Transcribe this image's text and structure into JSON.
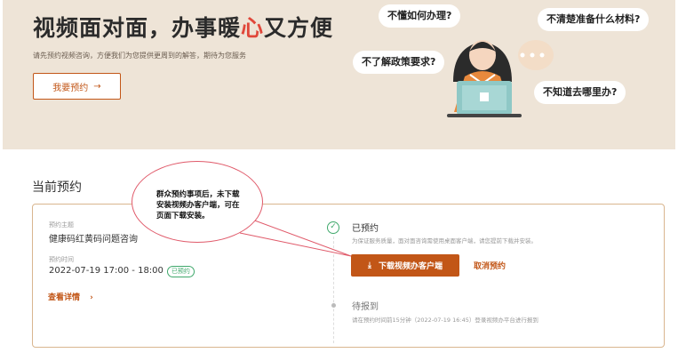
{
  "banner": {
    "title_pre": "视频面对面，办事暖",
    "title_heart": "心",
    "title_post": "又方便",
    "subtitle": "请先预约视频咨询，方便我们为您提供更周到的解答，期待为您服务",
    "book_button": "我要预约",
    "bubbles": [
      "不懂如何办理?",
      "不清楚准备什么材料?",
      "不了解政策要求?",
      "不知道去哪里办?"
    ]
  },
  "section_title": "当前预约",
  "card": {
    "subject_label": "预约主题",
    "subject_value": "健康码红黄码问题咨询",
    "time_label": "预约时间",
    "time_value": "2022-07-19 17:00 - 18:00",
    "status_badge": "已预约",
    "detail_link": "查看详情",
    "step1_title": "已预约",
    "step1_desc": "为保证服务质量，面对面咨询需使用桌面客户端，请您提前下载并安装。",
    "download_button": "下载视频办客户端",
    "cancel_link": "取消预约",
    "step2_title": "待报到",
    "step2_desc": "请在预约时间前15分钟（2022-07-19 16:45）登录视频办平台进行报到"
  },
  "callout": {
    "text": "群众预约事项后，未下载安装视频办客户端，可在页面下载安装。"
  },
  "colors": {
    "accent": "#c25617",
    "banner_bg": "#eee4d7",
    "success": "#3fa86b",
    "callout_border": "#e05a6a"
  },
  "icons": [
    "arrow-right-icon",
    "download-icon",
    "check-circle-icon",
    "chevron-right-icon",
    "customer-service-illustration"
  ]
}
